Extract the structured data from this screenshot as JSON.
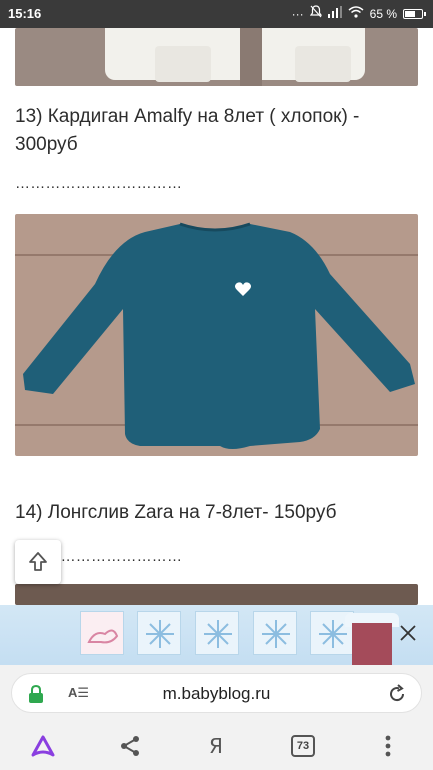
{
  "status_bar": {
    "time": "15:16",
    "battery": "65 %",
    "battery_level": 0.65,
    "icons": [
      "mute-icon",
      "wifi-icon",
      "signal-icon",
      "battery-icon"
    ]
  },
  "posts": [
    {
      "caption": "13) Кардиган Amalfy на 8лет ( хлопок) - 300руб",
      "dots": "……………………………",
      "image": "white-cardigan-photo"
    },
    {
      "caption": "14) Лонгслив Zara на 7-8лет- 150руб",
      "dots": "……………………………",
      "image": "teal-longsleeve-photo"
    }
  ],
  "ad": {
    "tiles": [
      "pink-logo-tile",
      "snowflake-tile",
      "snowflake-tile",
      "snowflake-tile",
      "snowflake-tile"
    ]
  },
  "address_bar": {
    "url": "m.babyblog.ru",
    "reader_icon_label": "A☰"
  },
  "bottom_nav": {
    "yandex_label": "Я",
    "tab_count": "73"
  },
  "colors": {
    "status_bar_bg": "#3a3a3a",
    "shirt_teal": "#1f5f78",
    "alice_purple": "#8a3fe0",
    "lock_green": "#2fa84f"
  }
}
